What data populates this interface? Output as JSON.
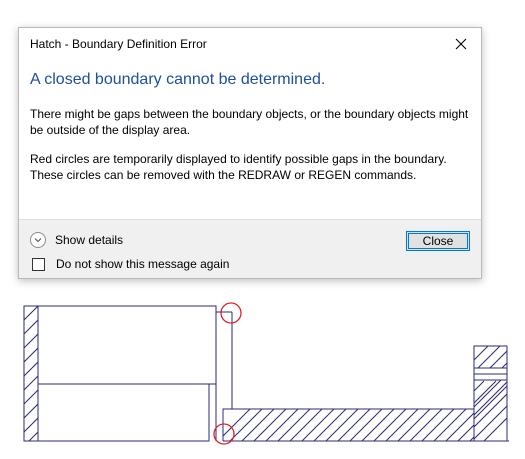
{
  "dialog": {
    "title": "Hatch - Boundary Definition Error",
    "heading": "A closed boundary cannot be determined.",
    "paragraph1": "There might be gaps between the boundary objects, or the boundary objects might be outside of the display area.",
    "paragraph2": "Red circles are temporarily displayed to identify possible gaps in the boundary. These circles can be removed with the REDRAW or REGEN commands.",
    "show_details_label": "Show details",
    "close_label": "Close",
    "checkbox_label": "Do not show this message again",
    "checkbox_checked": false
  },
  "icons": {
    "close": "close-icon",
    "expand": "chevron-down-icon"
  },
  "colors": {
    "heading": "#1e4fa0",
    "drawing_lines": "#2b2b7a",
    "gap_markers": "#e02020",
    "accent": "#0078d7"
  }
}
